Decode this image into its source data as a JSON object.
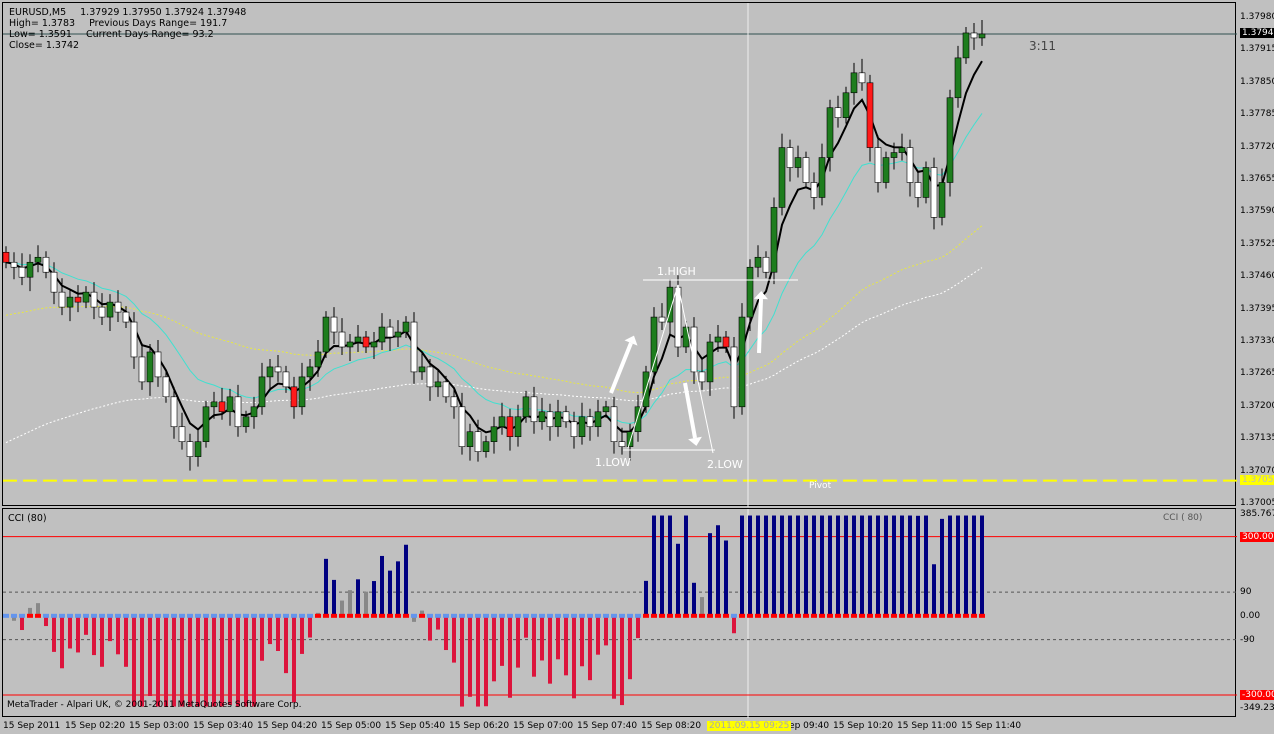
{
  "header": {
    "symbol": "EURUSD,M5",
    "ohlc": "1.37929 1.37950 1.37924 1.37948",
    "high": "High= 1.3783",
    "prev_range": "Previous Days Range= 191.7",
    "low": "Low= 1.3591",
    "cur_range": "Current Days Range= 93.2",
    "close": "Close= 1.3742"
  },
  "timer": "3:11",
  "annotations": {
    "high1": "1.HIGH",
    "low1": "1.LOW",
    "low2": "2.LOW",
    "pivot": "Pivot"
  },
  "cci_label": "CCI  ( 80)",
  "footer": "MetaTrader - Alpari UK, © 2001-2011 MetaQuotes Software Corp.",
  "colors": {
    "bull": "#1e7d1e",
    "bear": "#ffffff",
    "red": "#ff1a1a",
    "cci_neg": "#dc143c",
    "cci_pos": "#000080",
    "cyan": "#40e0d0",
    "pivot": "#ffff00"
  },
  "chart_data": [
    {
      "type": "candlestick",
      "title": "EURUSD,M5",
      "ylim": [
        1.37005,
        1.3798
      ],
      "price_ticks": [
        "1.37980",
        "1.37915",
        "1.37850",
        "1.37785",
        "1.37720",
        "1.37655",
        "1.37590",
        "1.37525",
        "1.37460",
        "1.37395",
        "1.37330",
        "1.37265",
        "1.37200",
        "1.37135",
        "1.37070",
        "1.37005"
      ],
      "current_price": "1.37948",
      "pivot_price": "1.37052",
      "pivot_value": 1.37052,
      "current_value": 1.37948,
      "closes": [
        1.3749,
        1.3748,
        1.3746,
        1.3749,
        1.375,
        1.3747,
        1.3743,
        1.374,
        1.3742,
        1.3741,
        1.3743,
        1.374,
        1.3738,
        1.3741,
        1.3739,
        1.3737,
        1.373,
        1.3725,
        1.3731,
        1.3726,
        1.3722,
        1.3716,
        1.3713,
        1.371,
        1.3713,
        1.372,
        1.3721,
        1.3719,
        1.3722,
        1.3716,
        1.3718,
        1.372,
        1.3726,
        1.3728,
        1.3727,
        1.3724,
        1.372,
        1.3726,
        1.3728,
        1.3731,
        1.3738,
        1.3735,
        1.3732,
        1.3733,
        1.3734,
        1.3732,
        1.3733,
        1.3736,
        1.3734,
        1.3735,
        1.3737,
        1.3727,
        1.3728,
        1.3724,
        1.3725,
        1.3722,
        1.372,
        1.3712,
        1.3715,
        1.3711,
        1.3713,
        1.3716,
        1.3718,
        1.3714,
        1.3718,
        1.3722,
        1.3717,
        1.3719,
        1.3716,
        1.3719,
        1.3717,
        1.3714,
        1.3718,
        1.3716,
        1.3719,
        1.372,
        1.3713,
        1.3712,
        1.3715,
        1.372,
        1.3727,
        1.3738,
        1.3737,
        1.3744,
        1.3732,
        1.3736,
        1.3727,
        1.3725,
        1.3733,
        1.3734,
        1.3732,
        1.372,
        1.3738,
        1.3748,
        1.375,
        1.3747,
        1.376,
        1.3772,
        1.3768,
        1.377,
        1.3765,
        1.3762,
        1.377,
        1.378,
        1.3778,
        1.3783,
        1.3787,
        1.3785,
        1.3772,
        1.3765,
        1.377,
        1.3771,
        1.3772,
        1.3765,
        1.3762,
        1.3768,
        1.3758,
        1.3765,
        1.3782,
        1.379,
        1.3795,
        1.3794,
        1.37948
      ],
      "ma_fast_period": 5,
      "ma_mid_period": 10,
      "ma_slow_seed": 1.3738,
      "ma_slow2_seed": 1.3712
    },
    {
      "type": "bar",
      "title": "CCI (80)",
      "ylim": [
        -349.238,
        385.767
      ],
      "levels": [
        "385.767",
        "300.000",
        "90",
        "0.00",
        "-90",
        "-300.000",
        "-349.238"
      ],
      "level_values": [
        300,
        90,
        0,
        -90,
        -300
      ]
    }
  ],
  "time_axis": {
    "labels": [
      "15 Sep 2011",
      "15 Sep 02:20",
      "15 Sep 03:00",
      "15 Sep 03:40",
      "15 Sep 04:20",
      "15 Sep 05:00",
      "15 Sep 05:40",
      "15 Sep 06:20",
      "15 Sep 07:00",
      "15 Sep 07:40",
      "15 Sep 08:20",
      "15 Sep 09:40",
      "15 Sep 10:20",
      "15 Sep 11:00",
      "15 Sep 11:40"
    ],
    "crosshair": "2011.09.15 09:25"
  }
}
